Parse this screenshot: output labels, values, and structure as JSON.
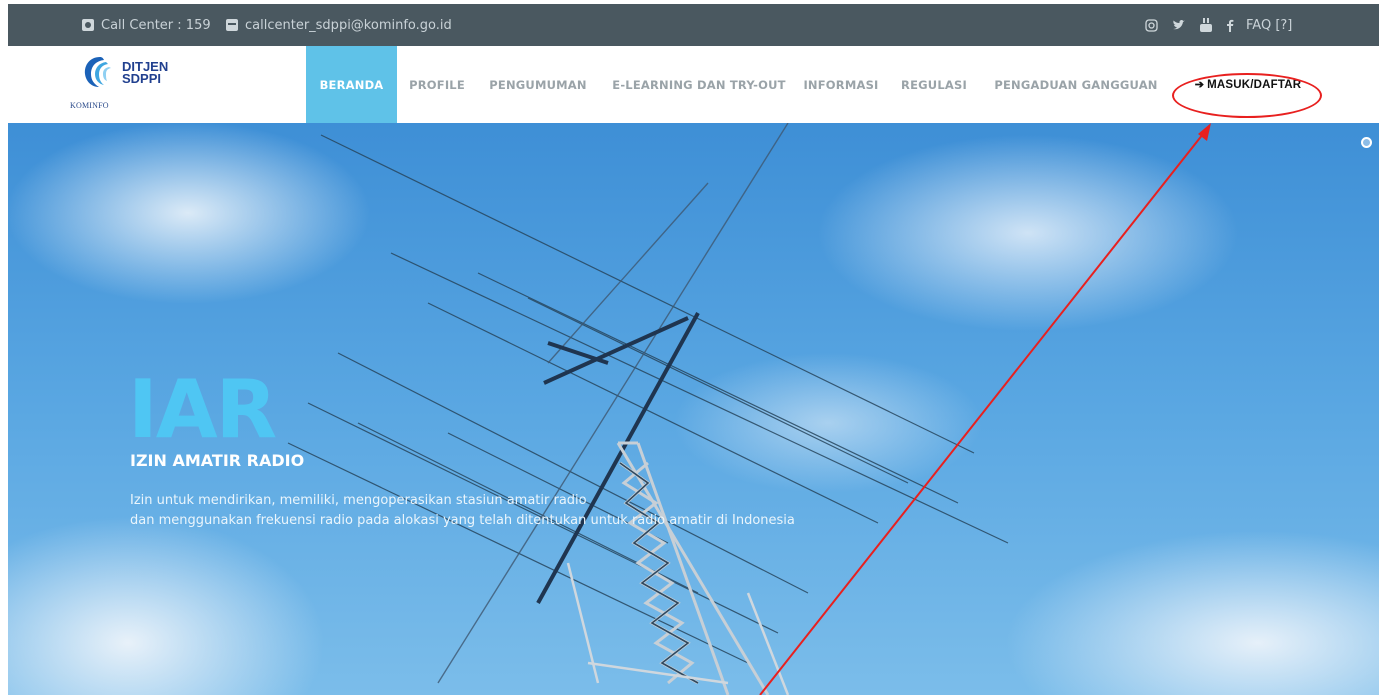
{
  "topbar": {
    "call_center": "Call Center : 159",
    "email": "callcenter_sdppi@kominfo.go.id",
    "social_icons": [
      "instagram-icon",
      "twitter-icon",
      "youtube-icon",
      "facebook-icon"
    ],
    "faq": "FAQ [?]"
  },
  "logo": {
    "line1": "DITJEN",
    "line2": "SDPPI",
    "org": "KOMINFO"
  },
  "nav": {
    "items": [
      {
        "label": "BERANDA",
        "active": true
      },
      {
        "label": "PROFILE",
        "active": false
      },
      {
        "label": "PENGUMUMAN",
        "active": false
      },
      {
        "label": "E-LEARNING DAN TRY-OUT",
        "active": false
      },
      {
        "label": "INFORMASI",
        "active": false
      },
      {
        "label": "REGULASI",
        "active": false
      },
      {
        "label": "PENGADUAN GANGGUAN",
        "active": false
      }
    ],
    "login": "MASUK/DAFTAR"
  },
  "hero": {
    "big": "IAR",
    "title": "IZIN AMATIR RADIO",
    "desc_line1": "Izin untuk mendirikan, memiliki, mengoperasikan stasiun amatir radio",
    "desc_line2": "dan menggunakan frekuensi radio pada alokasi yang telah ditentukan untuk radio amatir di Indonesia"
  },
  "colors": {
    "topbar": "#4a5860",
    "active_nav": "#5fc2e8",
    "hero_accent": "#4fc6f3",
    "annotation": "#e8201f"
  }
}
